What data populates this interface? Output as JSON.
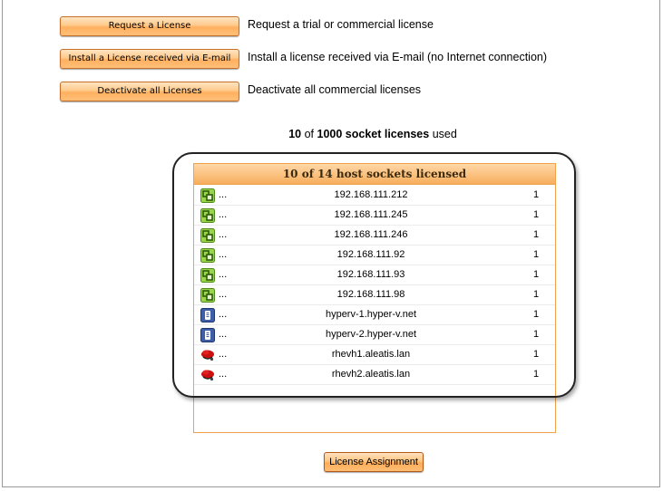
{
  "actions": [
    {
      "button": "Request a License",
      "description": "Request a trial or commercial license"
    },
    {
      "button": "Install a License received via E-mail",
      "description": "Install a license received via E-mail (no Internet connection)"
    },
    {
      "button": "Deactivate all Licenses",
      "description": "Deactivate all commercial licenses"
    }
  ],
  "summary": {
    "used": "10",
    "of": "of",
    "total": "1000 socket licenses",
    "suffix": "used"
  },
  "host_panel": {
    "header": "10 of 14 host sockets licensed",
    "rows": [
      {
        "icon": "vmware-host-icon",
        "dots": "...",
        "host": "192.168.111.212",
        "count": "1"
      },
      {
        "icon": "vmware-host-icon",
        "dots": "...",
        "host": "192.168.111.245",
        "count": "1"
      },
      {
        "icon": "vmware-host-icon",
        "dots": "...",
        "host": "192.168.111.246",
        "count": "1"
      },
      {
        "icon": "vmware-host-icon",
        "dots": "...",
        "host": "192.168.111.92",
        "count": "1"
      },
      {
        "icon": "vmware-host-icon",
        "dots": "...",
        "host": "192.168.111.93",
        "count": "1"
      },
      {
        "icon": "vmware-host-icon",
        "dots": "...",
        "host": "192.168.111.98",
        "count": "1"
      },
      {
        "icon": "hyperv-host-icon",
        "dots": "...",
        "host": "hyperv-1.hyper-v.net",
        "count": "1"
      },
      {
        "icon": "hyperv-host-icon",
        "dots": "...",
        "host": "hyperv-2.hyper-v.net",
        "count": "1"
      },
      {
        "icon": "redhat-host-icon",
        "dots": "...",
        "host": "rhevh1.aleatis.lan",
        "count": "1"
      },
      {
        "icon": "redhat-host-icon",
        "dots": "...",
        "host": "rhevh2.aleatis.lan",
        "count": "1"
      }
    ]
  },
  "assign_button": "License Assignment",
  "colors": {
    "accent": "#f7ad5c",
    "panel_border": "#f0a24a"
  }
}
